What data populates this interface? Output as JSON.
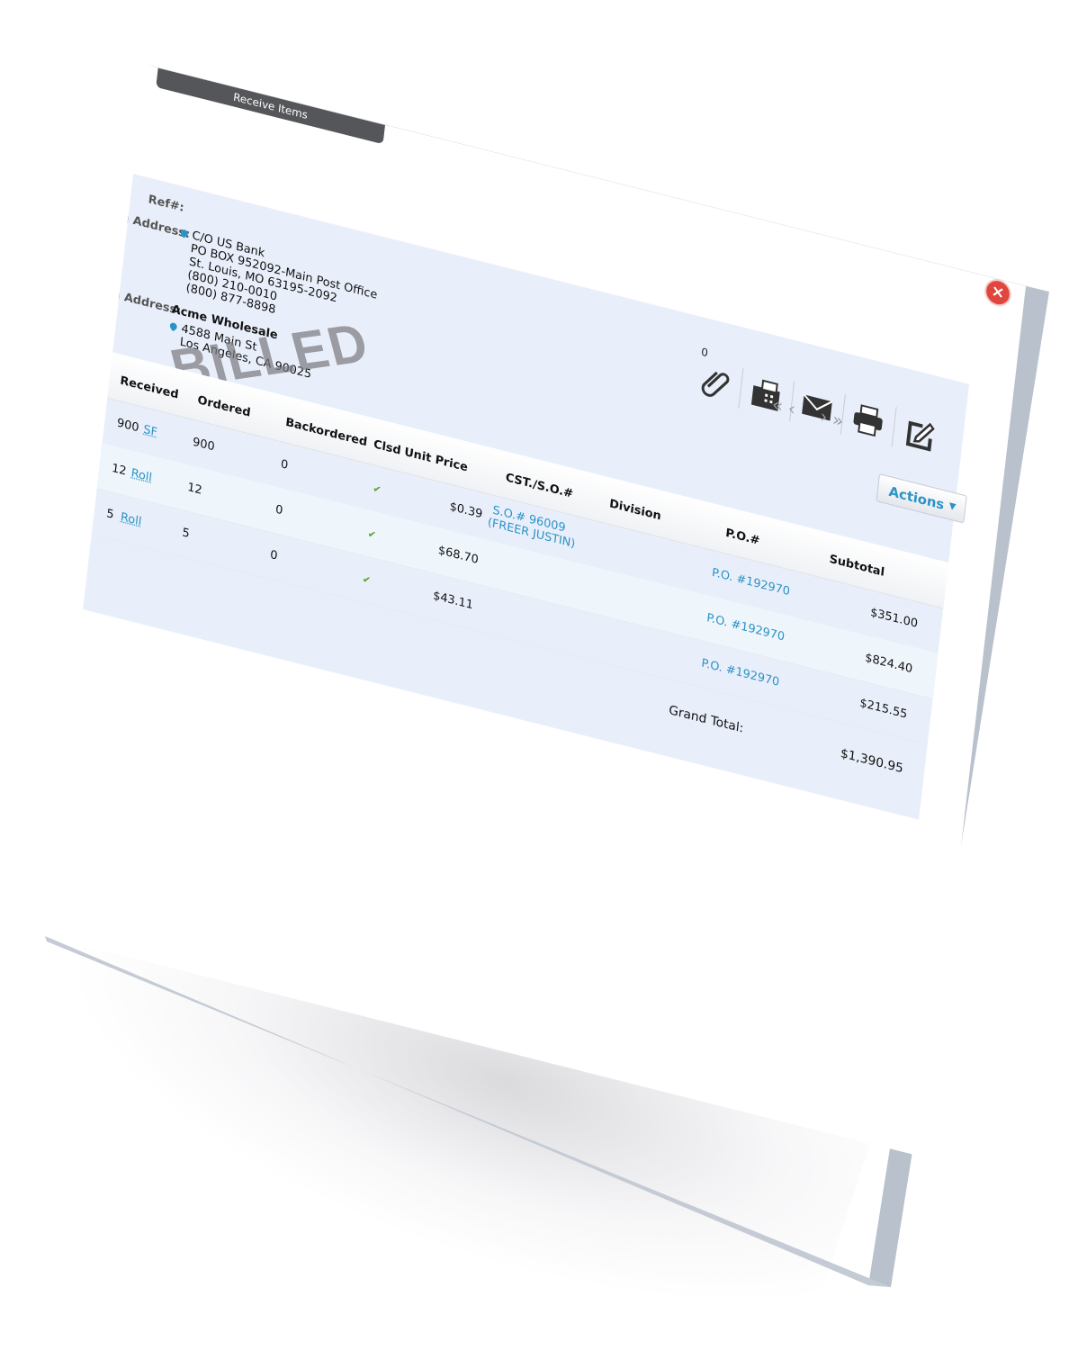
{
  "tab": {
    "label": "Receive Items"
  },
  "header": {
    "ref_label": "Ref#:",
    "billing_label": "g Address:",
    "billing_lines": [
      "C/O US Bank",
      "PO BOX 952092-Main Post Office",
      "St. Louis, MO 63195-2092",
      "(800) 210-0010",
      "(800) 877-8898"
    ],
    "shipping_label": "g Address:",
    "shipping_name": "Acme Wholesale",
    "shipping_lines": [
      "4588 Main St",
      "Los Angeles, CA 90025"
    ],
    "stamp": "BILLED"
  },
  "toolbar": {
    "attachment_count": "0",
    "icons": [
      "paperclip-icon",
      "fax-icon",
      "email-icon",
      "printer-icon",
      "edit-icon"
    ],
    "actions_label": "Actions"
  },
  "pager": {
    "first": "«",
    "prev": "‹",
    "next": "›",
    "last": "»"
  },
  "table": {
    "headers": {
      "received": "Received",
      "ordered": "Ordered",
      "backordered": "Backordered",
      "clsd": "Clsd",
      "unit_price": "Unit Price",
      "cst_so": "CST./S.O.#",
      "division": "Division",
      "po": "P.O.#",
      "subtotal": "Subtotal"
    },
    "rows": [
      {
        "received": "900",
        "unit": "SF",
        "ordered": "900",
        "backordered": "0",
        "clsd": "✔",
        "unit_price": "$0.39",
        "so": "S.O.# 96009",
        "so_name": "(FREER JUSTIN)",
        "po": "P.O. #192970",
        "subtotal": "$351.00"
      },
      {
        "received": "12",
        "unit": "Roll",
        "ordered": "12",
        "backordered": "0",
        "clsd": "✔",
        "unit_price": "$68.70",
        "so": "",
        "so_name": "",
        "po": "P.O. #192970",
        "subtotal": "$824.40"
      },
      {
        "received": "5",
        "unit": "Roll",
        "ordered": "5",
        "backordered": "0",
        "clsd": "✔",
        "unit_price": "$43.11",
        "so": "",
        "so_name": "",
        "po": "P.O. #192970",
        "subtotal": "$215.55"
      }
    ],
    "grand_total_label": "Grand Total:",
    "grand_total": "$1,390.95"
  }
}
